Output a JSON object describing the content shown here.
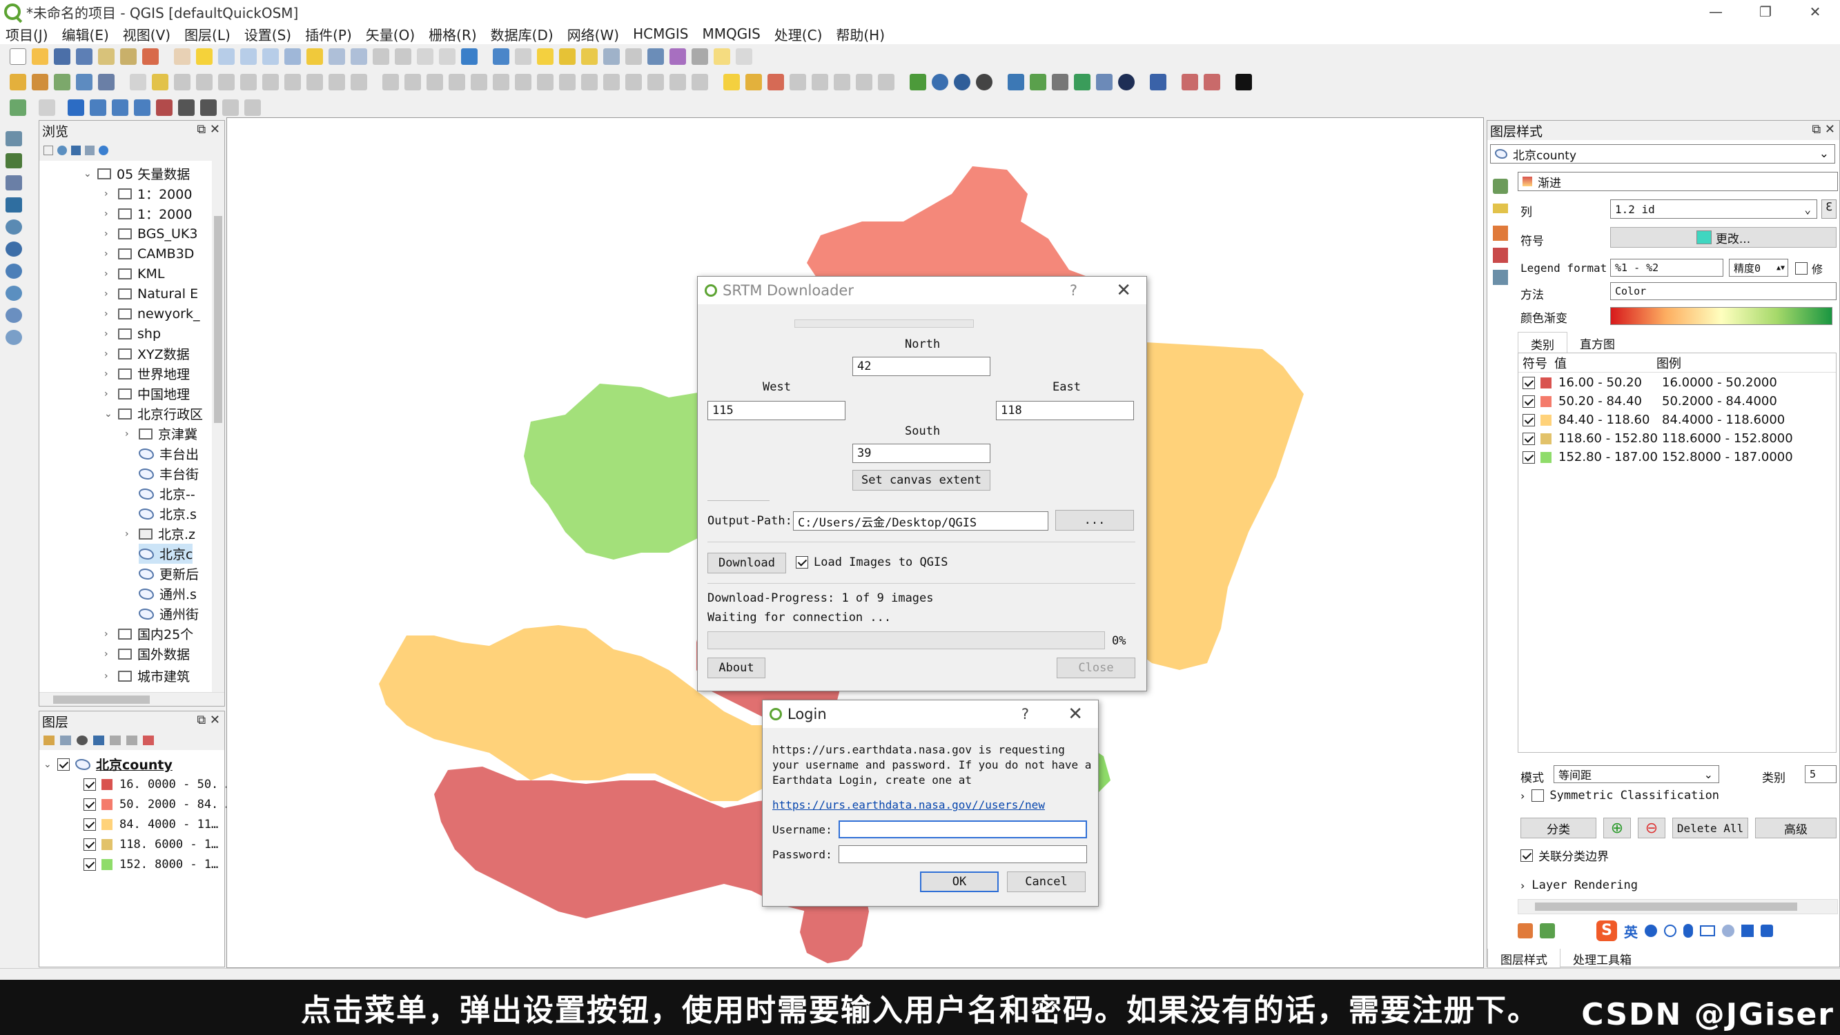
{
  "window": {
    "title": "*未命名的项目 - QGIS [defaultQuickOSM]",
    "controls": [
      "—",
      "❐",
      "✕"
    ]
  },
  "menu": [
    "项目(J)",
    "编辑(E)",
    "视图(V)",
    "图层(L)",
    "设置(S)",
    "插件(P)",
    "矢量(O)",
    "栅格(R)",
    "数据库(D)",
    "网络(W)",
    "HCMGIS",
    "MMQGIS",
    "处理(C)",
    "帮助(H)"
  ],
  "browser": {
    "title": "浏览",
    "items": [
      {
        "label": "05 矢量数据",
        "caret": "⌄"
      },
      {
        "label": "1：2000",
        "caret": "›"
      },
      {
        "label": "1：2000",
        "caret": "›"
      },
      {
        "label": "BGS_UK3",
        "caret": "›"
      },
      {
        "label": "CAMB3D",
        "caret": "›"
      },
      {
        "label": "KML",
        "caret": "›"
      },
      {
        "label": "Natural E",
        "caret": "›"
      },
      {
        "label": "newyork_",
        "caret": "›"
      },
      {
        "label": "shp",
        "caret": "›"
      },
      {
        "label": "XYZ数据",
        "caret": "›"
      },
      {
        "label": "世界地理",
        "caret": "›"
      },
      {
        "label": "中国地理",
        "caret": "›"
      },
      {
        "label": "北京行政区",
        "caret": "⌄"
      },
      {
        "label": "京津冀",
        "caret": "›"
      },
      {
        "label": "丰台出",
        "caret": ""
      },
      {
        "label": "丰台街",
        "caret": ""
      },
      {
        "label": "北京--",
        "caret": ""
      },
      {
        "label": "北京.s",
        "caret": ""
      },
      {
        "label": "北京.z",
        "caret": "›"
      },
      {
        "label": "北京c",
        "caret": ""
      },
      {
        "label": "更新后",
        "caret": ""
      },
      {
        "label": "通州.s",
        "caret": ""
      },
      {
        "label": "通州街",
        "caret": ""
      },
      {
        "label": "国内25个",
        "caret": "›"
      },
      {
        "label": "国外数据",
        "caret": "›"
      },
      {
        "label": "城市建筑",
        "caret": "›"
      }
    ]
  },
  "layers": {
    "title": "图层",
    "layer_name": "北京county",
    "classes": [
      {
        "label": "16. 0000 - 50. …",
        "color": "#d9534f"
      },
      {
        "label": "50. 2000 - 84. …",
        "color": "#f47b6b"
      },
      {
        "label": "84. 4000 - 11…",
        "color": "#ffd27a"
      },
      {
        "label": "118. 6000 - 1…",
        "color": "#e2c26a"
      },
      {
        "label": "152. 8000 - 1…",
        "color": "#8fdc6a"
      }
    ]
  },
  "srtm": {
    "title": "SRTM Downloader",
    "help": "?",
    "close_x": "✕",
    "north_label": "North",
    "north": "42",
    "west_label": "West",
    "west": "115",
    "east_label": "East",
    "east": "118",
    "south_label": "South",
    "south": "39",
    "set_extent": "Set canvas extent",
    "output_label": "Output-Path:",
    "output_path": "C:/Users/云金/Desktop/QGIS",
    "browse": "...",
    "download": "Download",
    "load_images": "Load Images to QGIS",
    "progress_text": "Download-Progress: 1 of 9 images",
    "waiting": "Waiting for connection ...",
    "percent": "0%",
    "progress": 0,
    "about": "About",
    "close": "Close"
  },
  "login": {
    "title": "Login",
    "help": "?",
    "close_x": "✕",
    "message1": "https://urs.earthdata.nasa.gov is requesting",
    "message2": "your username and password. If you do not have a",
    "message3": "Earthdata Login, create one at",
    "link": "https://urs.earthdata.nasa.gov//users/new",
    "username_label": "Username:",
    "password_label": "Password:",
    "username": "",
    "password": "",
    "ok": "OK",
    "cancel": "Cancel"
  },
  "style_panel": {
    "title": "图层样式",
    "layer": "北京county",
    "renderer": "渐进",
    "column_label": "列",
    "column": "1.2 id",
    "symbol_label": "符号",
    "symbol_change": "更改...",
    "symbol_color": "#3fd6c0",
    "legend_format_label": "Legend format",
    "legend_format": "%1 - %2",
    "precision": "精度0",
    "trim": "修",
    "method_label": "方法",
    "method": "Color",
    "ramp_label": "颜色渐变",
    "tabs": [
      "类别",
      "直方图"
    ],
    "table_headers": [
      "符号",
      "值",
      "图例"
    ],
    "classes": [
      {
        "value": "16.00 - 50.20",
        "legend": "16.0000 - 50.2000",
        "color": "#d9534f"
      },
      {
        "value": "50.20 - 84.40",
        "legend": "50.2000 - 84.4000",
        "color": "#f47b6b"
      },
      {
        "value": "84.40 - 118.60",
        "legend": "84.4000 - 118.6000",
        "color": "#ffd27a"
      },
      {
        "value": "118.60 - 152.80",
        "legend": "118.6000 - 152.8000",
        "color": "#e2c26a"
      },
      {
        "value": "152.80 - 187.00",
        "legend": "152.8000 - 187.0000",
        "color": "#8fdc6a"
      }
    ],
    "mode_label": "模式",
    "mode": "等间距",
    "classes_label": "类别",
    "classes_count": "5",
    "symmetric": "Symmetric Classification",
    "classify": "分类",
    "delete_all": "Delete All",
    "advanced": "高级",
    "link_bounds": "关联分类边界",
    "layer_rendering": "Layer Rendering",
    "bottom_tabs": [
      "图层样式",
      "处理工具箱"
    ],
    "ime_label": "英"
  },
  "subtitle": "点击菜单，弹出设置按钮，使用时需要输入用户名和密码。如果没有的话，需要注册下。",
  "credit": "CSDN @JGiser"
}
